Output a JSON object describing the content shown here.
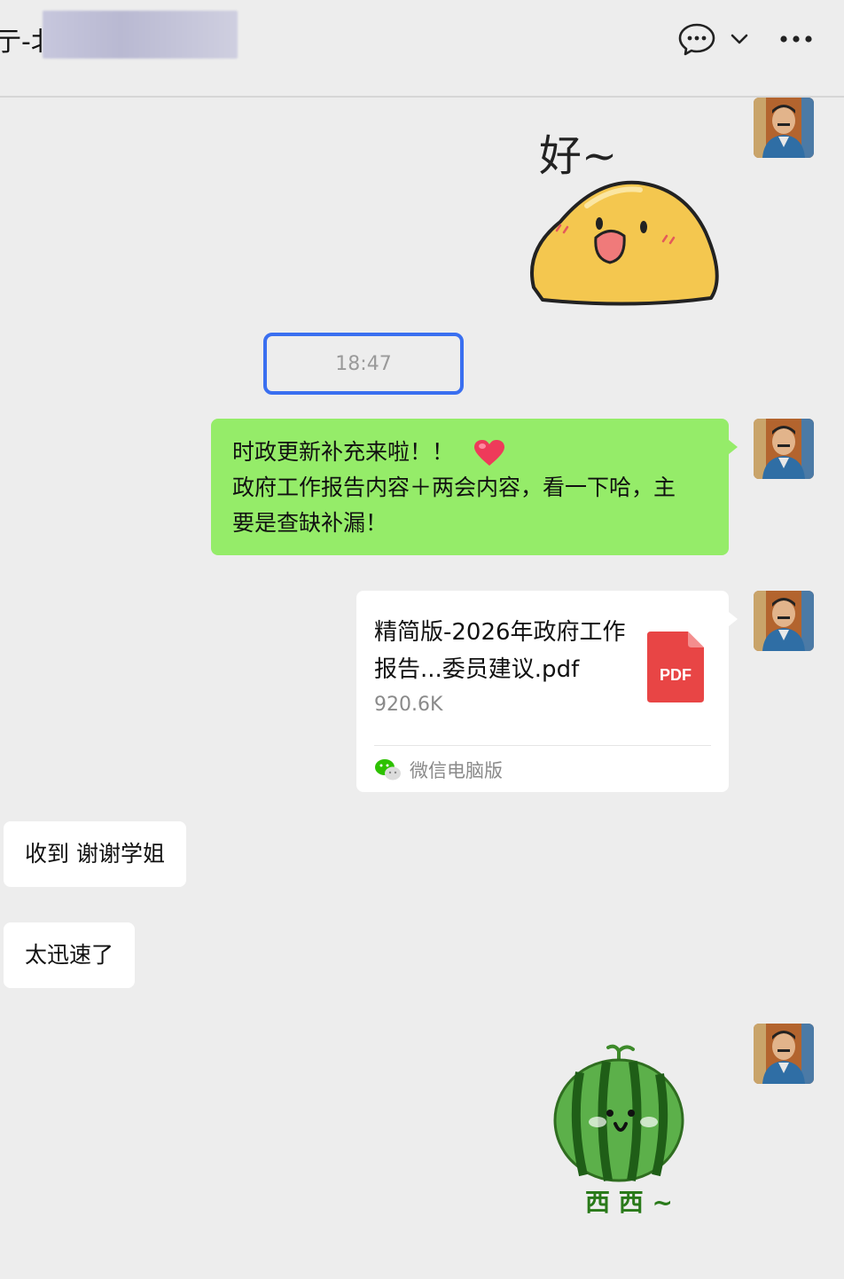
{
  "header": {
    "title": "亍-北",
    "icons": [
      "chat-bubble-icon",
      "chevron-down-icon",
      "more-icon"
    ]
  },
  "messages": {
    "sticker_1": {
      "caption": "好~"
    },
    "timestamp": "18:47",
    "text_message": {
      "line1": "时政更新补充来啦！！",
      "line2": "政府工作报告内容＋两会内容，看一下哈，主",
      "line3": "要是查缺补漏！"
    },
    "file_message": {
      "file_name": "精简版-2026年政府工作报告...委员建议.pdf",
      "file_size": "920.6K",
      "file_type": "PDF",
      "source": "微信电脑版"
    },
    "reply_1": "收到 谢谢学姐",
    "reply_2": "太迅速了",
    "sticker_2": {
      "caption": "西 西 ~"
    }
  },
  "colors": {
    "background": "#ededed",
    "bubble_green": "#95ec69",
    "bubble_white": "#ffffff",
    "highlight_box": "#3a6ff0",
    "pdf_red": "#e84545"
  }
}
